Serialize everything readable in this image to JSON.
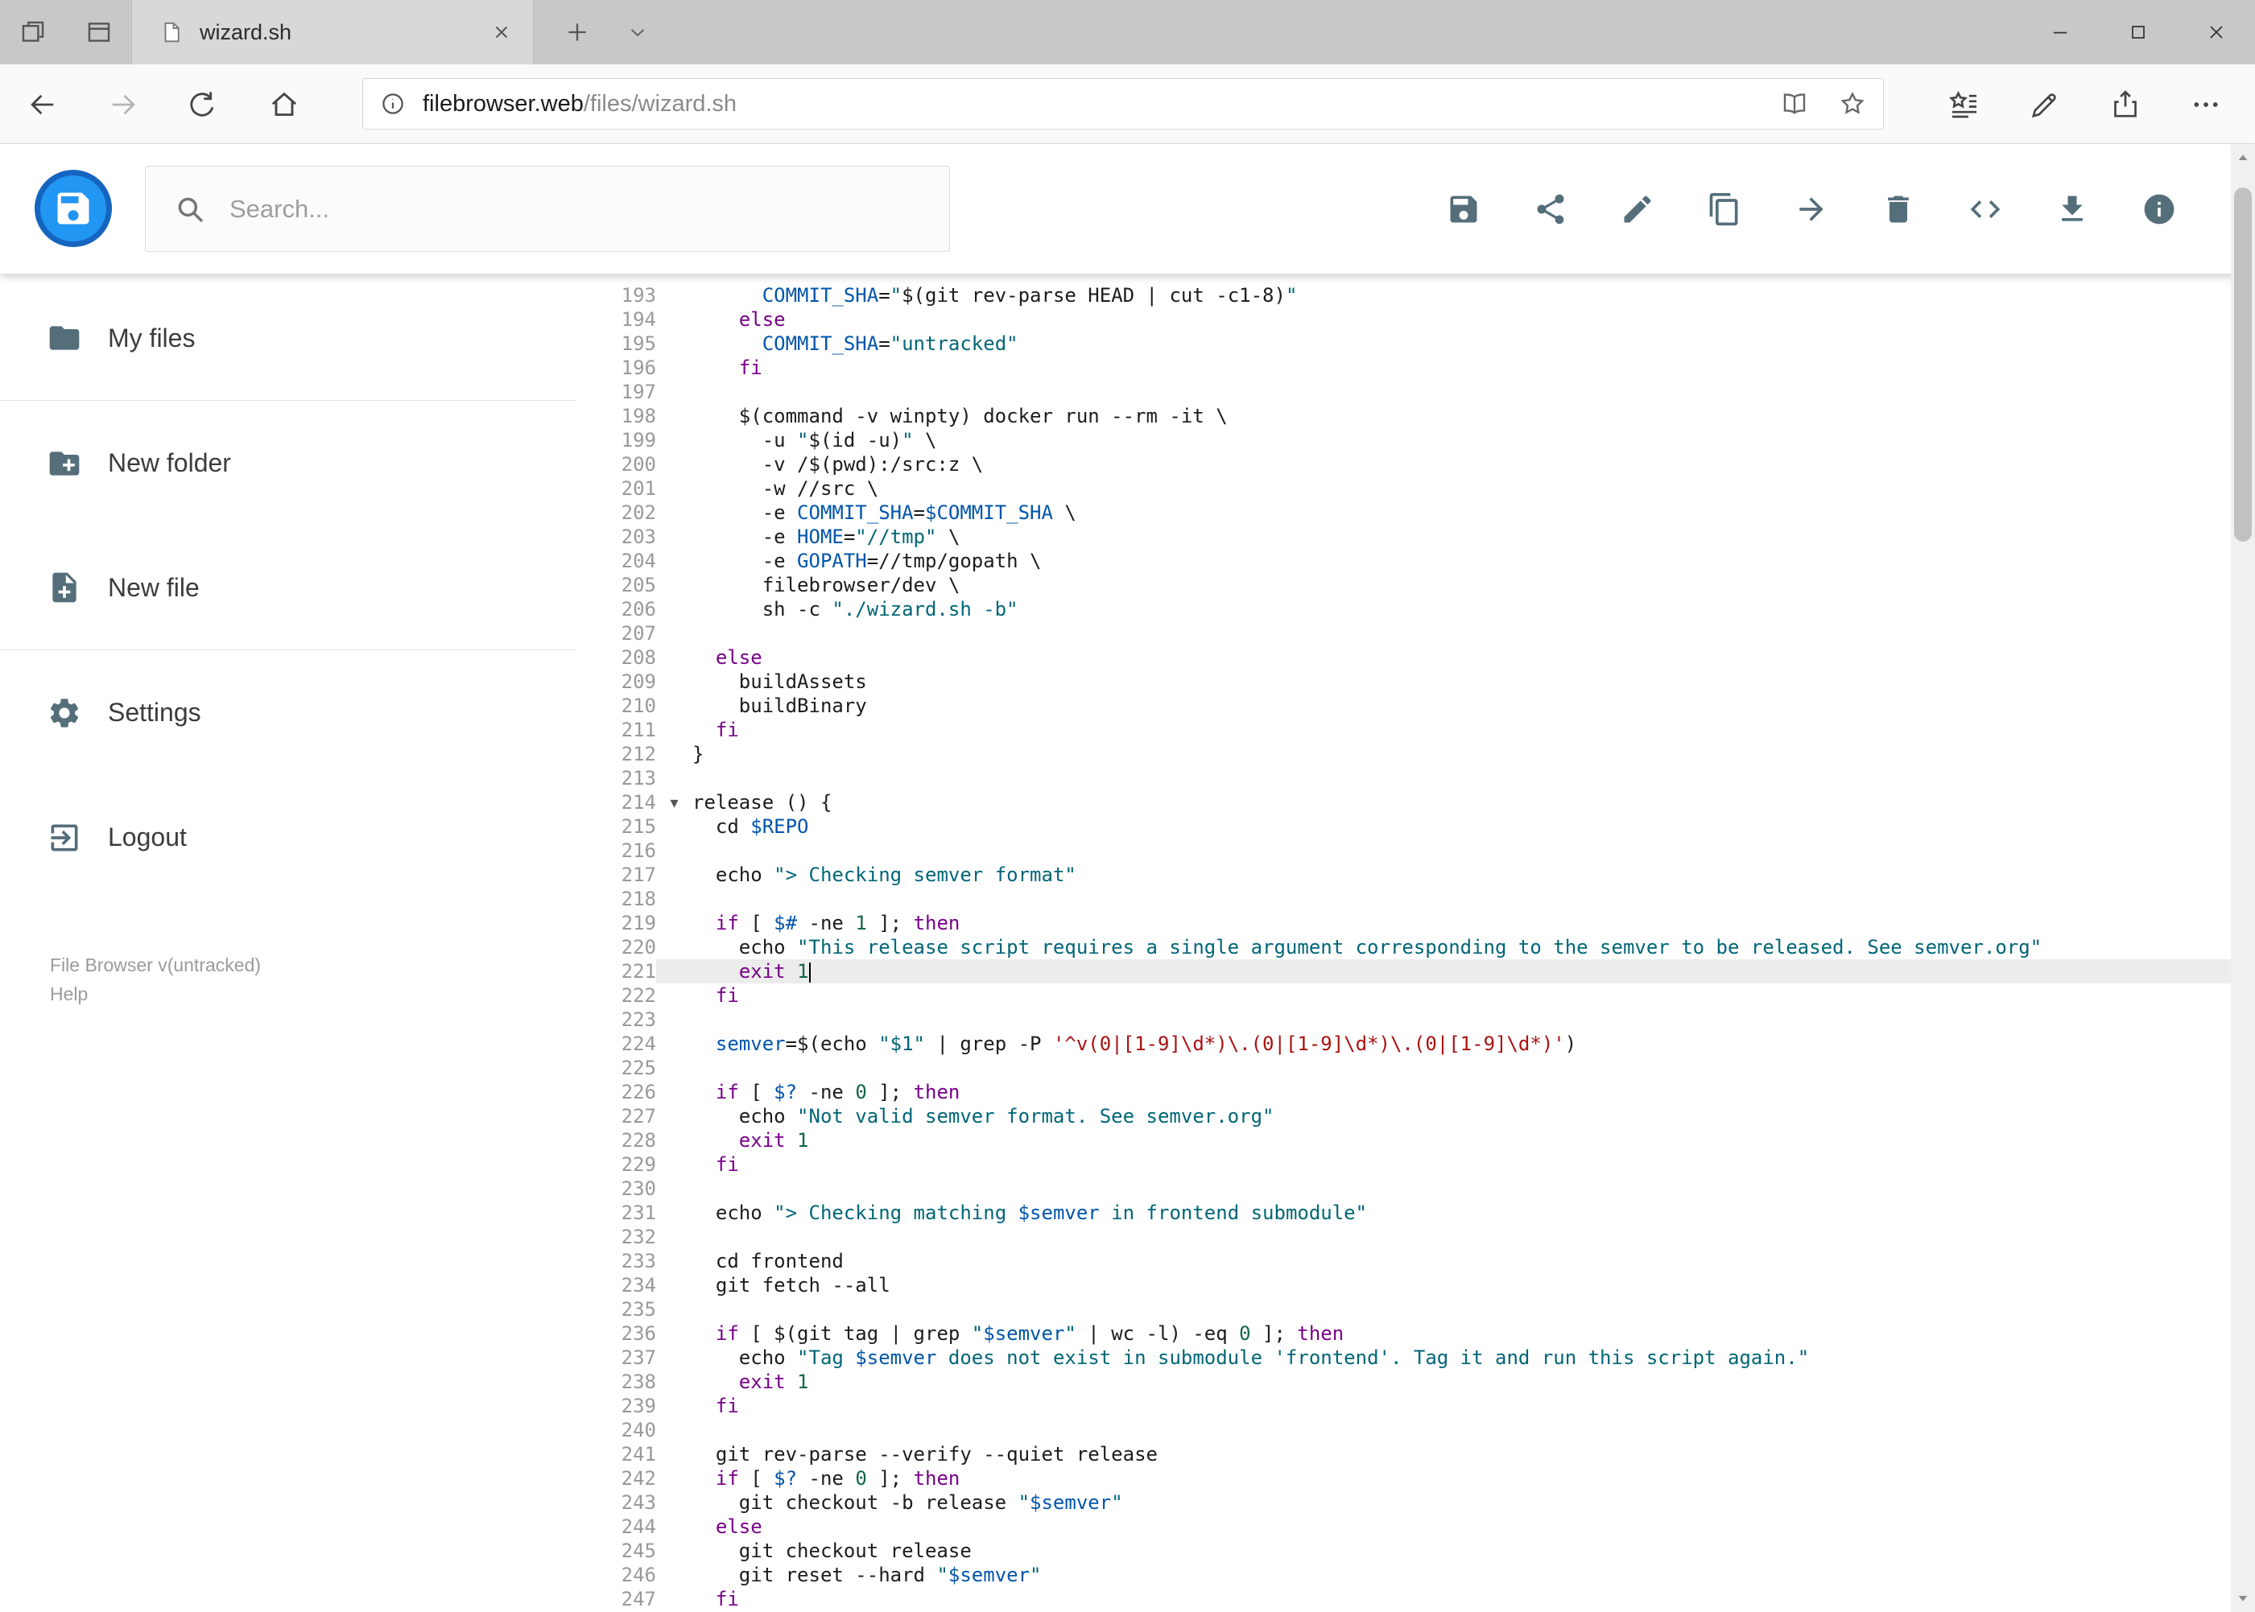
{
  "browser": {
    "tab_title": "wizard.sh",
    "url_host": "filebrowser.web",
    "url_path": "/files/wizard.sh",
    "tab_icons": [
      "set-tabs-aside",
      "tab-preview",
      "page-favicon",
      "close-tab",
      "new-tab",
      "tab-list-chevron"
    ],
    "nav_icons": [
      "back",
      "forward",
      "refresh",
      "home"
    ],
    "url_icons": [
      "info",
      "reading-view",
      "favorite-star"
    ],
    "action_icons": [
      "hub",
      "annotate",
      "share",
      "more"
    ],
    "window_controls": [
      "minimize",
      "maximize",
      "close"
    ]
  },
  "header": {
    "search_placeholder": "Search...",
    "toolbar_icons": [
      "save",
      "share",
      "edit",
      "copy",
      "move",
      "delete",
      "code",
      "download",
      "info"
    ],
    "accent_blue": "#2196f3"
  },
  "sidebar": {
    "items": [
      {
        "label": "My files",
        "icon": "folder-icon"
      },
      {
        "label": "New folder",
        "icon": "new-folder-icon"
      },
      {
        "label": "New file",
        "icon": "new-file-icon"
      },
      {
        "label": "Settings",
        "icon": "settings-icon"
      },
      {
        "label": "Logout",
        "icon": "logout-icon"
      }
    ],
    "version": "File Browser v(untracked)",
    "help": "Help",
    "icon_color": "#546e7a"
  },
  "editor": {
    "active_line": 221,
    "cursor_line": 221,
    "fold_line": 214,
    "colors": {
      "t": "#1c1c1c",
      "k": "#770088",
      "s": "#006677",
      "v": "#0055aa",
      "n": "#116644",
      "r": "#aa1111",
      "ln": "#999999"
    },
    "active_line_bg": "#ececec",
    "lines": [
      {
        "n": 193,
        "seg": [
          [
            "t",
            "      "
          ],
          [
            "v",
            "COMMIT_SHA"
          ],
          [
            "t",
            "="
          ],
          [
            "s",
            "\""
          ],
          [
            "t",
            "$(git rev-parse HEAD | cut -c1-8)"
          ],
          [
            "s",
            "\""
          ]
        ]
      },
      {
        "n": 194,
        "seg": [
          [
            "t",
            "    "
          ],
          [
            "k",
            "else"
          ]
        ]
      },
      {
        "n": 195,
        "seg": [
          [
            "t",
            "      "
          ],
          [
            "v",
            "COMMIT_SHA"
          ],
          [
            "t",
            "="
          ],
          [
            "s",
            "\"untracked\""
          ]
        ]
      },
      {
        "n": 196,
        "seg": [
          [
            "t",
            "    "
          ],
          [
            "k",
            "fi"
          ]
        ]
      },
      {
        "n": 197,
        "seg": []
      },
      {
        "n": 198,
        "seg": [
          [
            "t",
            "    $(command -v winpty) docker run --rm -it \\"
          ]
        ]
      },
      {
        "n": 199,
        "seg": [
          [
            "t",
            "      -u "
          ],
          [
            "s",
            "\""
          ],
          [
            "t",
            "$(id -u)"
          ],
          [
            "s",
            "\""
          ],
          [
            "t",
            " \\"
          ]
        ]
      },
      {
        "n": 200,
        "seg": [
          [
            "t",
            "      -v /$(pwd):/src:z \\"
          ]
        ]
      },
      {
        "n": 201,
        "seg": [
          [
            "t",
            "      -w //src \\"
          ]
        ]
      },
      {
        "n": 202,
        "seg": [
          [
            "t",
            "      -e "
          ],
          [
            "v",
            "COMMIT_SHA"
          ],
          [
            "t",
            "="
          ],
          [
            "v",
            "$COMMIT_SHA"
          ],
          [
            "t",
            " \\"
          ]
        ]
      },
      {
        "n": 203,
        "seg": [
          [
            "t",
            "      -e "
          ],
          [
            "v",
            "HOME"
          ],
          [
            "t",
            "="
          ],
          [
            "s",
            "\"//tmp\""
          ],
          [
            "t",
            " \\"
          ]
        ]
      },
      {
        "n": 204,
        "seg": [
          [
            "t",
            "      -e "
          ],
          [
            "v",
            "GOPATH"
          ],
          [
            "t",
            "=//tmp/gopath \\"
          ]
        ]
      },
      {
        "n": 205,
        "seg": [
          [
            "t",
            "      filebrowser/dev \\"
          ]
        ]
      },
      {
        "n": 206,
        "seg": [
          [
            "t",
            "      sh -c "
          ],
          [
            "s",
            "\"./wizard.sh -b\""
          ]
        ]
      },
      {
        "n": 207,
        "seg": []
      },
      {
        "n": 208,
        "seg": [
          [
            "t",
            "  "
          ],
          [
            "k",
            "else"
          ]
        ]
      },
      {
        "n": 209,
        "seg": [
          [
            "t",
            "    buildAssets"
          ]
        ]
      },
      {
        "n": 210,
        "seg": [
          [
            "t",
            "    buildBinary"
          ]
        ]
      },
      {
        "n": 211,
        "seg": [
          [
            "t",
            "  "
          ],
          [
            "k",
            "fi"
          ]
        ]
      },
      {
        "n": 212,
        "seg": [
          [
            "t",
            "}"
          ]
        ]
      },
      {
        "n": 213,
        "seg": []
      },
      {
        "n": 214,
        "seg": [
          [
            "t",
            "release () {"
          ]
        ]
      },
      {
        "n": 215,
        "seg": [
          [
            "t",
            "  cd "
          ],
          [
            "v",
            "$REPO"
          ]
        ]
      },
      {
        "n": 216,
        "seg": []
      },
      {
        "n": 217,
        "seg": [
          [
            "t",
            "  echo "
          ],
          [
            "s",
            "\"> Checking semver format\""
          ]
        ]
      },
      {
        "n": 218,
        "seg": []
      },
      {
        "n": 219,
        "seg": [
          [
            "t",
            "  "
          ],
          [
            "k",
            "if"
          ],
          [
            "t",
            " [ "
          ],
          [
            "v",
            "$#"
          ],
          [
            "t",
            " -ne "
          ],
          [
            "n",
            "1"
          ],
          [
            "t",
            " ]; "
          ],
          [
            "k",
            "then"
          ]
        ]
      },
      {
        "n": 220,
        "seg": [
          [
            "t",
            "    echo "
          ],
          [
            "s",
            "\"This release script requires a single argument corresponding to the semver to be released. See semver.org\""
          ]
        ]
      },
      {
        "n": 221,
        "seg": [
          [
            "t",
            "    "
          ],
          [
            "k",
            "exit"
          ],
          [
            "t",
            " "
          ],
          [
            "n",
            "1"
          ]
        ]
      },
      {
        "n": 222,
        "seg": [
          [
            "t",
            "  "
          ],
          [
            "k",
            "fi"
          ]
        ]
      },
      {
        "n": 223,
        "seg": []
      },
      {
        "n": 224,
        "seg": [
          [
            "t",
            "  "
          ],
          [
            "v",
            "semver"
          ],
          [
            "t",
            "=$(echo "
          ],
          [
            "s",
            "\"$1\""
          ],
          [
            "t",
            " | grep -P "
          ],
          [
            "r",
            "'^v(0|[1-9]\\d*)\\.(0|[1-9]\\d*)\\.(0|[1-9]\\d*)'"
          ],
          [
            "t",
            ")"
          ]
        ]
      },
      {
        "n": 225,
        "seg": []
      },
      {
        "n": 226,
        "seg": [
          [
            "t",
            "  "
          ],
          [
            "k",
            "if"
          ],
          [
            "t",
            " [ "
          ],
          [
            "v",
            "$?"
          ],
          [
            "t",
            " -ne "
          ],
          [
            "n",
            "0"
          ],
          [
            "t",
            " ]; "
          ],
          [
            "k",
            "then"
          ]
        ]
      },
      {
        "n": 227,
        "seg": [
          [
            "t",
            "    echo "
          ],
          [
            "s",
            "\"Not valid semver format. See semver.org\""
          ]
        ]
      },
      {
        "n": 228,
        "seg": [
          [
            "t",
            "    "
          ],
          [
            "k",
            "exit"
          ],
          [
            "t",
            " "
          ],
          [
            "n",
            "1"
          ]
        ]
      },
      {
        "n": 229,
        "seg": [
          [
            "t",
            "  "
          ],
          [
            "k",
            "fi"
          ]
        ]
      },
      {
        "n": 230,
        "seg": []
      },
      {
        "n": 231,
        "seg": [
          [
            "t",
            "  echo "
          ],
          [
            "s",
            "\"> Checking matching "
          ],
          [
            "v",
            "$semver"
          ],
          [
            "s",
            " in frontend submodule\""
          ]
        ]
      },
      {
        "n": 232,
        "seg": []
      },
      {
        "n": 233,
        "seg": [
          [
            "t",
            "  cd frontend"
          ]
        ]
      },
      {
        "n": 234,
        "seg": [
          [
            "t",
            "  git fetch --all"
          ]
        ]
      },
      {
        "n": 235,
        "seg": []
      },
      {
        "n": 236,
        "seg": [
          [
            "t",
            "  "
          ],
          [
            "k",
            "if"
          ],
          [
            "t",
            " [ $(git tag | grep "
          ],
          [
            "s",
            "\""
          ],
          [
            "v",
            "$semver"
          ],
          [
            "s",
            "\""
          ],
          [
            "t",
            " | wc -l) -eq "
          ],
          [
            "n",
            "0"
          ],
          [
            "t",
            " ]; "
          ],
          [
            "k",
            "then"
          ]
        ]
      },
      {
        "n": 237,
        "seg": [
          [
            "t",
            "    echo "
          ],
          [
            "s",
            "\"Tag "
          ],
          [
            "v",
            "$semver"
          ],
          [
            "s",
            " does not exist in submodule 'frontend'. Tag it and run this script again.\""
          ]
        ]
      },
      {
        "n": 238,
        "seg": [
          [
            "t",
            "    "
          ],
          [
            "k",
            "exit"
          ],
          [
            "t",
            " "
          ],
          [
            "n",
            "1"
          ]
        ]
      },
      {
        "n": 239,
        "seg": [
          [
            "t",
            "  "
          ],
          [
            "k",
            "fi"
          ]
        ]
      },
      {
        "n": 240,
        "seg": []
      },
      {
        "n": 241,
        "seg": [
          [
            "t",
            "  git rev-parse --verify --quiet release"
          ]
        ]
      },
      {
        "n": 242,
        "seg": [
          [
            "t",
            "  "
          ],
          [
            "k",
            "if"
          ],
          [
            "t",
            " [ "
          ],
          [
            "v",
            "$?"
          ],
          [
            "t",
            " -ne "
          ],
          [
            "n",
            "0"
          ],
          [
            "t",
            " ]; "
          ],
          [
            "k",
            "then"
          ]
        ]
      },
      {
        "n": 243,
        "seg": [
          [
            "t",
            "    git checkout -b release "
          ],
          [
            "s",
            "\""
          ],
          [
            "v",
            "$semver"
          ],
          [
            "s",
            "\""
          ]
        ]
      },
      {
        "n": 244,
        "seg": [
          [
            "t",
            "  "
          ],
          [
            "k",
            "else"
          ]
        ]
      },
      {
        "n": 245,
        "seg": [
          [
            "t",
            "    git checkout release"
          ]
        ]
      },
      {
        "n": 246,
        "seg": [
          [
            "t",
            "    git reset --hard "
          ],
          [
            "s",
            "\""
          ],
          [
            "v",
            "$semver"
          ],
          [
            "s",
            "\""
          ]
        ]
      },
      {
        "n": 247,
        "seg": [
          [
            "t",
            "  "
          ],
          [
            "k",
            "fi"
          ]
        ]
      }
    ]
  }
}
